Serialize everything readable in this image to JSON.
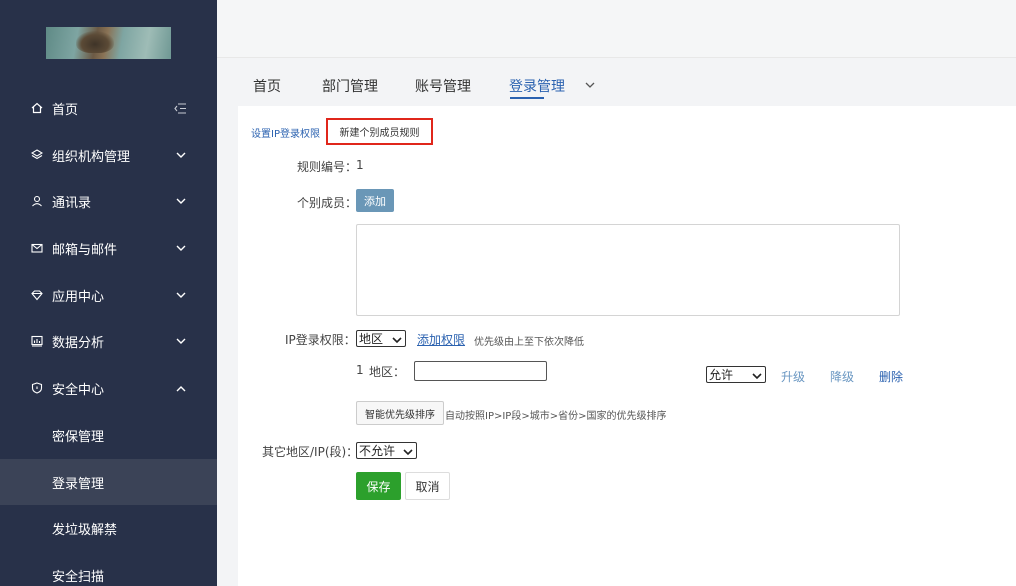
{
  "sidebar": {
    "items": [
      {
        "label": "首页",
        "icon": "home-icon"
      },
      {
        "label": "组织机构管理",
        "icon": "layers-icon"
      },
      {
        "label": "通讯录",
        "icon": "contacts-icon"
      },
      {
        "label": "邮箱与邮件",
        "icon": "mail-icon"
      },
      {
        "label": "应用中心",
        "icon": "diamond-icon"
      },
      {
        "label": "数据分析",
        "icon": "chart-icon"
      },
      {
        "label": "安全中心",
        "icon": "shield-icon"
      }
    ],
    "sub_items": [
      {
        "label": "密保管理"
      },
      {
        "label": "登录管理",
        "active": true
      },
      {
        "label": "发垃圾解禁"
      },
      {
        "label": "安全扫描"
      }
    ],
    "bg_color": "#283149",
    "active_bg": "#3b4357"
  },
  "tabs": [
    {
      "label": "首页"
    },
    {
      "label": "部门管理"
    },
    {
      "label": "账号管理"
    },
    {
      "label": "登录管理",
      "active": true
    }
  ],
  "content": {
    "set_ip_link": "设置IP登录权限",
    "new_rule_tab": "新建个别成员规则",
    "rule_no_label": "规则编号：",
    "rule_no_value": "1",
    "member_label": "个别成员：",
    "add_button": "添加",
    "ip_label": "IP登录权限：",
    "ip_select": "地区",
    "add_permission_link": "添加权限",
    "priority_hint": "优先级由上至下依次降低",
    "row_index": "1",
    "region_label": "地区：",
    "region_value": "",
    "allow_select": "允许",
    "upgrade": "升级",
    "downgrade": "降级",
    "delete": "删除",
    "smart_sort_button": "智能优先级排序",
    "smart_sort_hint": "自动按照IP>IP段>城市>省份>国家的优先级排序",
    "other_label": "其它地区/IP(段)：",
    "other_select": "不允许",
    "save_button": "保存",
    "cancel_button": "取消"
  },
  "colors": {
    "accent": "#2b62b0",
    "save": "#2ca02c",
    "add_button": "#6a97b7",
    "highlight_border": "#e0261b"
  }
}
